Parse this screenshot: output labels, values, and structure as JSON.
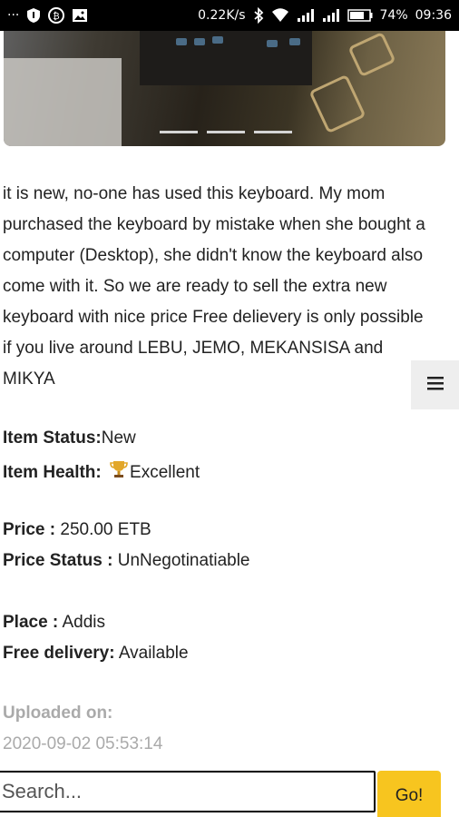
{
  "status_bar": {
    "dots": "···",
    "speed": "0.22K/s",
    "battery": "74%",
    "time": "09:36"
  },
  "icons": [
    "menu-dots-icon",
    "shield-icon",
    "bitcoin-icon",
    "image-icon",
    "bluetooth-icon",
    "wifi-icon",
    "signal-icon",
    "battery-icon",
    "hamburger-menu-icon",
    "trophy-icon"
  ],
  "description": "it is new, no-one has used this keyboard. My mom purchased the keyboard by mistake when she bought a computer (Desktop), she didn't know the keyboard also come with it. So we are ready to sell the extra new keyboard with nice price Free delievery is only possible if you live around LEBU, JEMO, MEKANSISA and MIKYA",
  "item": {
    "status_label": "Item Status:",
    "status_value": "New",
    "health_label": "Item Health:",
    "health_value": "Excellent",
    "price_label": "Price :",
    "price_value": "250.00 ETB",
    "price_status_label": "Price Status :",
    "price_status_value": "UnNegotinatiable",
    "place_label": "Place :",
    "place_value": "Addis",
    "delivery_label": "Free delivery:",
    "delivery_value": "Available"
  },
  "uploaded": {
    "label": "Uploaded on:",
    "value": "2020-09-02 05:53:14"
  },
  "search": {
    "placeholder": "Search...",
    "button_label": "Go!"
  },
  "colors": {
    "accent": "#f7c51f",
    "muted": "#aaaaaa"
  }
}
